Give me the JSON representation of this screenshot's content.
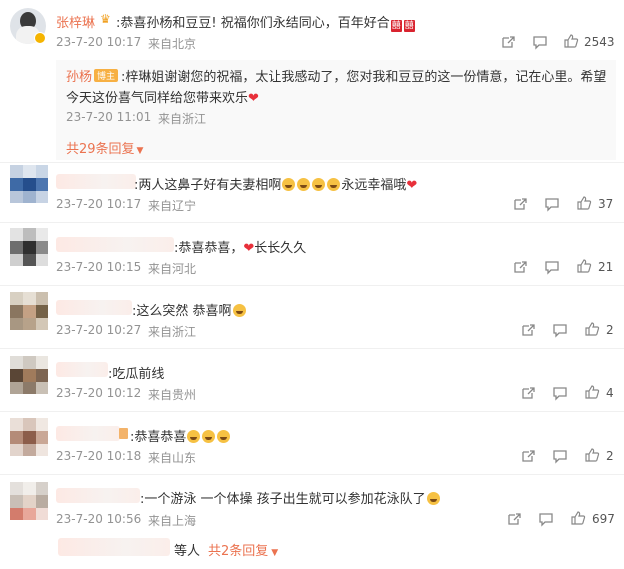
{
  "top_comment": {
    "author": "张梓琳",
    "text": ":恭喜孙杨和豆豆! 祝福你们永结同心，百年好合",
    "time": "23-7-20 10:17",
    "location": "来自北京",
    "likes": "2543",
    "reply": {
      "author": "孙杨",
      "badge": "博主",
      "text_line1": ":梓琳姐谢谢您的祝福，太让我感动了，您对我和豆豆的这一份情意，记在心里。希望",
      "text_line2": "今天这份喜气同样给您带来欢乐",
      "time": "23-7-20 11:01",
      "location": "来自浙江"
    },
    "more_replies": "共29条回复"
  },
  "comments": [
    {
      "text": ":两人这鼻子好有夫妻相啊",
      "text_after": "永远幸福哦",
      "time": "23-7-20 10:17",
      "location": "来自辽宁",
      "likes": "37"
    },
    {
      "text": ":恭喜恭喜，",
      "text_after": "长长久久",
      "time": "23-7-20 10:15",
      "location": "来自河北",
      "likes": "21"
    },
    {
      "text": ":这么突然 恭喜啊",
      "time": "23-7-20 10:27",
      "location": "来自浙江",
      "likes": "2"
    },
    {
      "text": ":吃瓜前线",
      "time": "23-7-20 10:12",
      "location": "来自贵州",
      "likes": "4"
    },
    {
      "text": ":恭喜恭喜",
      "time": "23-7-20 10:18",
      "location": "来自山东",
      "likes": "2"
    },
    {
      "text": ":一个游泳 一个体操 孩子出生就可以参加花泳队了",
      "time": "23-7-20 10:56",
      "location": "来自上海",
      "likes": "697"
    }
  ],
  "footer": {
    "text": "等人",
    "more_replies": "共2条回复"
  },
  "icons": [
    "share-icon",
    "comment-icon",
    "like-icon",
    "chevron-down-icon"
  ],
  "colors": {
    "accent": "#eb7350",
    "heart": "#e8303a",
    "meta": "#939393"
  }
}
